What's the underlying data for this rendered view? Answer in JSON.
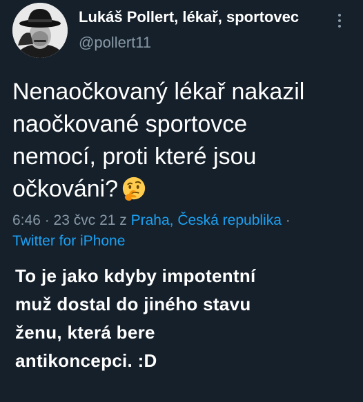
{
  "tweet": {
    "display_name": "Lukáš Pollert, lékař, sportovec",
    "handle": "@pollert11",
    "text_lines": [
      "Nenaočkovaný lékař nakazil",
      "naočkované sportovce",
      "nemocí, proti které jsou",
      "očkováni?"
    ],
    "emoji": "thinking-face",
    "time": "6:46",
    "separator": " · ",
    "date": "23 čvc 21",
    "location_prefix": " z ",
    "location": "Praha, Česká republika",
    "trailing_separator": " ·",
    "source": "Twitter for iPhone"
  },
  "caption": {
    "lines": [
      "To je jako kdyby impotentní",
      "muž dostal do jiného stavu",
      "ženu, která bere",
      "antikoncepci. :D"
    ]
  },
  "colors": {
    "background": "#15202b",
    "text": "#ffffff",
    "secondary": "#8899a6",
    "link": "#1da1f2"
  }
}
